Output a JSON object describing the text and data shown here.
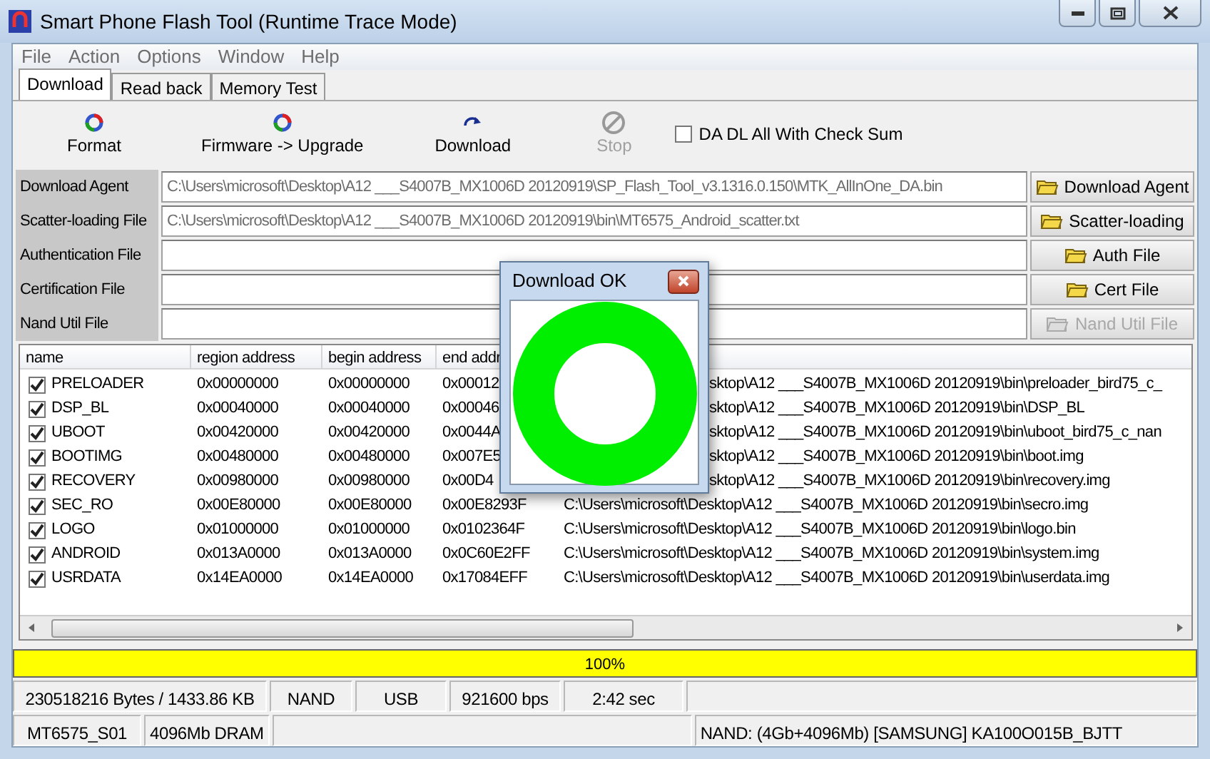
{
  "window": {
    "title": "Smart Phone Flash Tool (Runtime Trace Mode)"
  },
  "menu": [
    "File",
    "Action",
    "Options",
    "Window",
    "Help"
  ],
  "tabs": [
    {
      "label": "Download",
      "selected": true
    },
    {
      "label": "Read back",
      "selected": false
    },
    {
      "label": "Memory Test",
      "selected": false
    }
  ],
  "toolbar": {
    "buttons": [
      {
        "label": "Format",
        "kind": "format",
        "disabled": false
      },
      {
        "label": "Firmware -> Upgrade",
        "kind": "upgrade",
        "disabled": false
      },
      {
        "label": "Download",
        "kind": "download",
        "disabled": false
      },
      {
        "label": "Stop",
        "kind": "stop",
        "disabled": true
      }
    ],
    "checkbox": {
      "label": "DA DL All With Check Sum",
      "checked": false
    }
  },
  "file_rows": [
    {
      "label": "Download Agent",
      "value": "C:\\Users\\microsoft\\Desktop\\A12 ___S4007B_MX1006D 20120919\\SP_Flash_Tool_v3.1316.0.150\\MTK_AllInOne_DA.bin",
      "button": "Download Agent",
      "disabled": false
    },
    {
      "label": "Scatter-loading File",
      "value": "C:\\Users\\microsoft\\Desktop\\A12 ___S4007B_MX1006D 20120919\\bin\\MT6575_Android_scatter.txt",
      "button": "Scatter-loading",
      "disabled": false
    },
    {
      "label": "Authentication File",
      "button": "Auth File",
      "disabled": false
    },
    {
      "label": "Certification File",
      "button": "Cert File",
      "disabled": false
    },
    {
      "label": "Nand Util File",
      "button": "Nand Util File",
      "disabled": true
    }
  ],
  "table": {
    "columns": [
      "name",
      "region address",
      "begin address",
      "end addr"
    ],
    "rows": [
      {
        "checked": true,
        "covered": true,
        "cells": [
          "PRELOADER",
          "0x00000000",
          "0x00000000",
          "0x00012",
          "sktop\\A12 ___S4007B_MX1006D 20120919\\bin\\preloader_bird75_c_"
        ]
      },
      {
        "checked": true,
        "covered": true,
        "cells": [
          "DSP_BL",
          "0x00040000",
          "0x00040000",
          "0x00046",
          "sktop\\A12 ___S4007B_MX1006D 20120919\\bin\\DSP_BL"
        ]
      },
      {
        "checked": true,
        "covered": true,
        "cells": [
          "UBOOT",
          "0x00420000",
          "0x00420000",
          "0x0044A",
          "sktop\\A12 ___S4007B_MX1006D 20120919\\bin\\uboot_bird75_c_nan"
        ]
      },
      {
        "checked": true,
        "covered": true,
        "cells": [
          "BOOTIMG",
          "0x00480000",
          "0x00480000",
          "0x007E5",
          "sktop\\A12 ___S4007B_MX1006D 20120919\\bin\\boot.img"
        ]
      },
      {
        "checked": true,
        "covered": true,
        "cells": [
          "RECOVERY",
          "0x00980000",
          "0x00980000",
          "0x00D4",
          "sktop\\A12 ___S4007B_MX1006D 20120919\\bin\\recovery.img"
        ]
      },
      {
        "checked": true,
        "covered": false,
        "cells": [
          "SEC_RO",
          "0x00E80000",
          "0x00E80000",
          "0x00E8293F",
          "C:\\Users\\microsoft\\Desktop\\A12 ___S4007B_MX1006D 20120919\\bin\\secro.img"
        ]
      },
      {
        "checked": true,
        "covered": false,
        "cells": [
          "LOGO",
          "0x01000000",
          "0x01000000",
          "0x0102364F",
          "C:\\Users\\microsoft\\Desktop\\A12 ___S4007B_MX1006D 20120919\\bin\\logo.bin"
        ]
      },
      {
        "checked": true,
        "covered": false,
        "cells": [
          "ANDROID",
          "0x013A0000",
          "0x013A0000",
          "0x0C60E2FF",
          "C:\\Users\\microsoft\\Desktop\\A12 ___S4007B_MX1006D 20120919\\bin\\system.img"
        ]
      },
      {
        "checked": true,
        "covered": false,
        "cells": [
          "USRDATA",
          "0x14EA0000",
          "0x14EA0000",
          "0x17084EFF",
          "C:\\Users\\microsoft\\Desktop\\A12 ___S4007B_MX1006D 20120919\\bin\\userdata.img"
        ]
      }
    ]
  },
  "progress": {
    "level": 1,
    "text": "100%"
  },
  "status_bar": {
    "row_1": [
      "230518216 Bytes / 1433.86 KB",
      "NAND",
      "USB",
      "921600 bps",
      "2:42 sec"
    ],
    "row_2_left": [
      "MT6575_S01",
      "4096Mb DRAM"
    ],
    "row_2_right": "NAND: (4Gb+4096Mb) [SAMSUNG] KA100O015B_BJTT"
  },
  "dialog": {
    "title": "Download OK"
  }
}
